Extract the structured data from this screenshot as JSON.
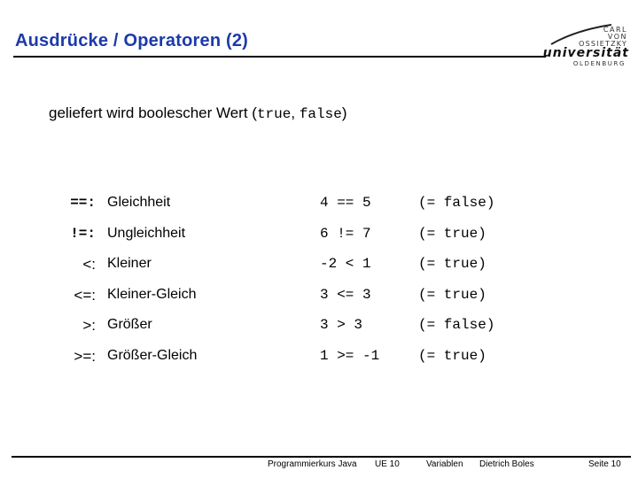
{
  "slide": {
    "title": "Ausdrücke / Operatoren (2)",
    "title_color": "#1c3aaa",
    "logo": {
      "line1": "CARL",
      "line2": "VON",
      "line3": "OSSIETZKY",
      "name": "universität",
      "city": "OLDENBURG"
    },
    "intro": {
      "text": "geliefert wird boolescher Wert (",
      "true_literal": "true",
      "separator": ", ",
      "false_literal": "false",
      "close": ")"
    },
    "operators": [
      {
        "op": "==:",
        "name": "Gleichheit",
        "example": "4 == 5",
        "result": "(= false)"
      },
      {
        "op": "!=:",
        "name": "Ungleichheit",
        "example": "6 != 7",
        "result": "(= true)"
      },
      {
        "op": "<:",
        "name": "Kleiner",
        "example": "-2 < 1",
        "result": "(= true)"
      },
      {
        "op": "<=:",
        "name": "Kleiner-Gleich",
        "example": "3 <= 3",
        "result": "(= true)"
      },
      {
        "op": ">:",
        "name": "Größer",
        "example": "3 > 3",
        "result": "(= false)"
      },
      {
        "op": ">=:",
        "name": "Größer-Gleich",
        "example": "1 >= -1",
        "result": "(= true)"
      }
    ],
    "footer": {
      "course": "Programmierkurs Java",
      "unit": "UE 10",
      "topic": "Variablen",
      "author": "Dietrich Boles",
      "page": "Seite 10"
    }
  }
}
